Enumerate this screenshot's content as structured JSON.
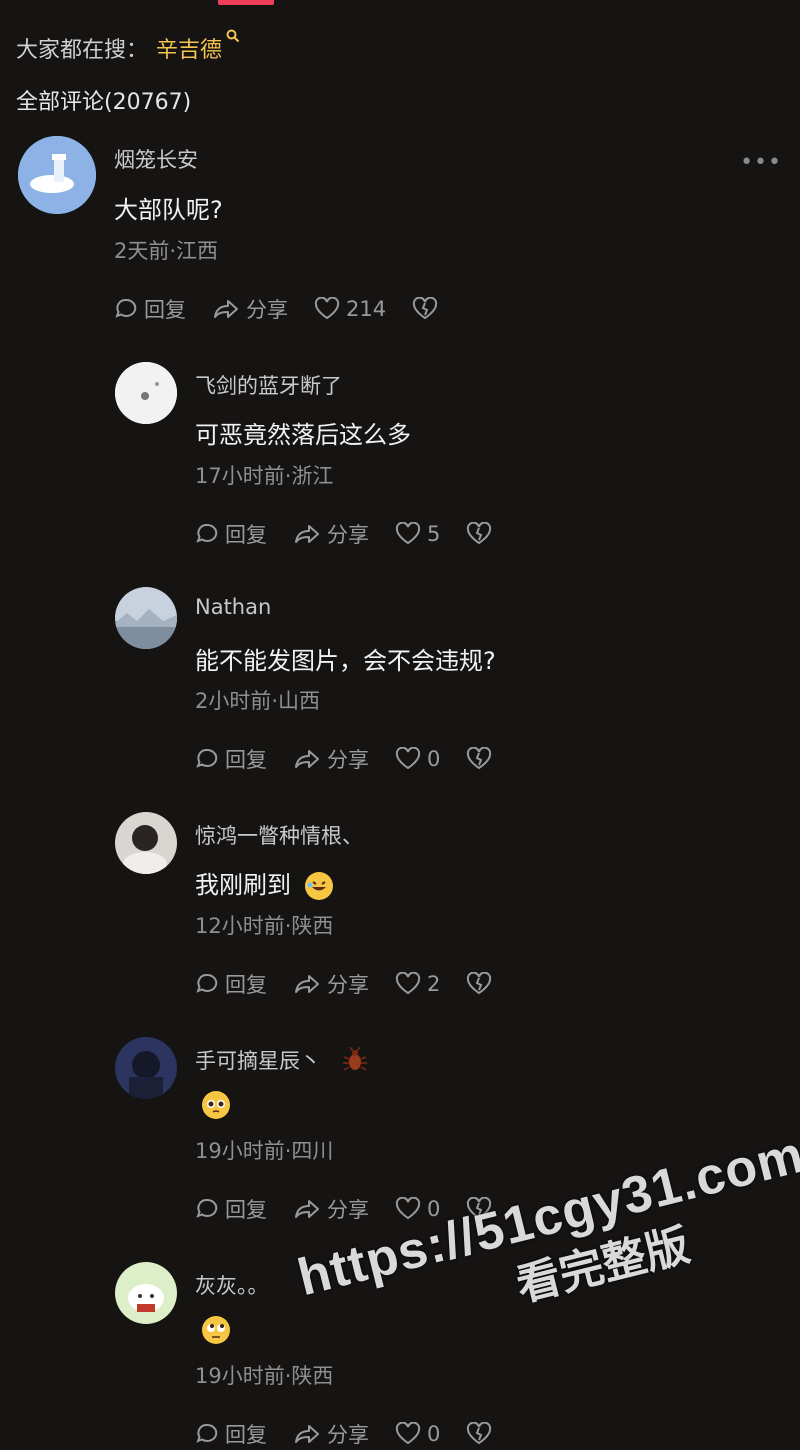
{
  "search_hint": {
    "prefix": "大家都在搜：",
    "keyword": "辛吉德"
  },
  "comments_header": {
    "title": "全部评论(20767)"
  },
  "comments": [
    {
      "name": "烟笼长安",
      "text": "大部队呢?",
      "meta": "2天前·江西",
      "reply": "回复",
      "share": "分享",
      "likes": "214"
    },
    {
      "name": "飞剑的蓝牙断了",
      "text": "可恶竟然落后这么多",
      "meta": "17小时前·浙江",
      "reply": "回复",
      "share": "分享",
      "likes": "5"
    },
    {
      "name": "Nathan",
      "text": "能不能发图片，会不会违规?",
      "meta": "2小时前·山西",
      "reply": "回复",
      "share": "分享",
      "likes": "0"
    },
    {
      "name": "惊鸿一瞥种情根、",
      "text": "我刚刷到",
      "meta": "12小时前·陕西",
      "reply": "回复",
      "share": "分享",
      "likes": "2"
    },
    {
      "name": "手可摘星辰丶",
      "text": "",
      "meta": "19小时前·四川",
      "reply": "回复",
      "share": "分享",
      "likes": "0"
    },
    {
      "name": "灰灰。。",
      "text": "",
      "meta": "19小时前·陕西",
      "reply": "回复",
      "share": "分享",
      "likes": "0"
    }
  ],
  "watermark": {
    "line1": "https://51cgy31.com",
    "line2": "看完整版"
  },
  "colors": {
    "background": "#161313",
    "accent": "#ee3f5a",
    "keyword": "#f5c452"
  }
}
